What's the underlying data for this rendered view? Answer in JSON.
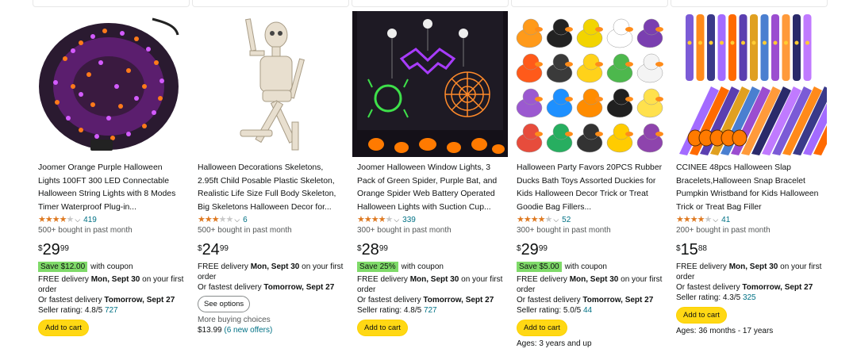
{
  "products": [
    {
      "title": "Joomer Orange Purple Halloween Lights 100FT 300 LED Connectable Halloween String Lights with 8 Modes Timer Waterproof Plug-in...",
      "rating": 4.5,
      "review_count": "419",
      "bought": "500+ bought in past month",
      "price": {
        "symbol": "$",
        "whole": "29",
        "fraction": "99"
      },
      "coupon": {
        "badge": "Save $12.00",
        "text": "with coupon"
      },
      "delivery_prefix": "FREE delivery ",
      "delivery_date": "Mon, Sept 30",
      "delivery_suffix": " on your first order",
      "fastest_prefix": "Or fastest delivery ",
      "fastest_date": "Tomorrow, Sept 27",
      "seller_label": "Seller rating: 4.8/5 ",
      "seller_count": "727",
      "button": "Add to cart"
    },
    {
      "title": "Halloween Decorations Skeletons, 2.95ft Child Posable Plastic Skeleton, Realistic Life Size Full Body Skeleton, Big Skeletons Halloween Decor for...",
      "rating": 3.5,
      "review_count": "6",
      "bought": "500+ bought in past month",
      "price": {
        "symbol": "$",
        "whole": "24",
        "fraction": "99"
      },
      "delivery_prefix": "FREE delivery ",
      "delivery_date": "Mon, Sept 30",
      "delivery_suffix": " on your first order",
      "fastest_prefix": "Or fastest delivery ",
      "fastest_date": "Tomorrow, Sept 27",
      "button": "See options",
      "more_buying": "More buying choices",
      "more_price": "$13.99 ",
      "more_offers": "(6 new offers)"
    },
    {
      "title": "Joomer Halloween Window Lights, 3 Pack of Green Spider, Purple Bat, and Orange Spider Web Battery Operated Halloween Lights with Suction Cup...",
      "rating": 4.5,
      "review_count": "339",
      "bought": "300+ bought in past month",
      "price": {
        "symbol": "$",
        "whole": "28",
        "fraction": "99"
      },
      "coupon": {
        "badge": "Save 25%",
        "text": "with coupon"
      },
      "delivery_prefix": "FREE delivery ",
      "delivery_date": "Mon, Sept 30",
      "delivery_suffix": " on your first order",
      "fastest_prefix": "Or fastest delivery ",
      "fastest_date": "Tomorrow, Sept 27",
      "seller_label": "Seller rating: 4.8/5 ",
      "seller_count": "727",
      "button": "Add to cart"
    },
    {
      "title": "Halloween Party Favors 20PCS Rubber Ducks Bath Toys Assorted Duckies for Kids Halloween Decor Trick or Treat Goodie Bag Fillers...",
      "rating": 4.5,
      "review_count": "52",
      "bought": "300+ bought in past month",
      "price": {
        "symbol": "$",
        "whole": "29",
        "fraction": "99"
      },
      "coupon": {
        "badge": "Save $5.00",
        "text": "with coupon"
      },
      "delivery_prefix": "FREE delivery ",
      "delivery_date": "Mon, Sept 30",
      "delivery_suffix": " on your first order",
      "fastest_prefix": "Or fastest delivery ",
      "fastest_date": "Tomorrow, Sept 27",
      "seller_label": "Seller rating: 5.0/5 ",
      "seller_count": "44",
      "button": "Add to cart",
      "ages": "Ages: 3 years and up"
    },
    {
      "title": "CCINEE 48pcs Halloween Slap Bracelets,Halloween Snap Bracelet Pumpkin Wristband for Kids Halloween Trick or Treat Bag Filler",
      "rating": 4.5,
      "review_count": "41",
      "bought": "200+ bought in past month",
      "price": {
        "symbol": "$",
        "whole": "15",
        "fraction": "88"
      },
      "delivery_prefix": "FREE delivery ",
      "delivery_date": "Mon, Sept 30",
      "delivery_suffix": " on your first order",
      "fastest_prefix": "Or fastest delivery ",
      "fastest_date": "Tomorrow, Sept 27",
      "seller_label": "Seller rating: 4.3/5 ",
      "seller_count": "325",
      "button": "Add to cart",
      "ages": "Ages: 36 months - 17 years"
    }
  ]
}
